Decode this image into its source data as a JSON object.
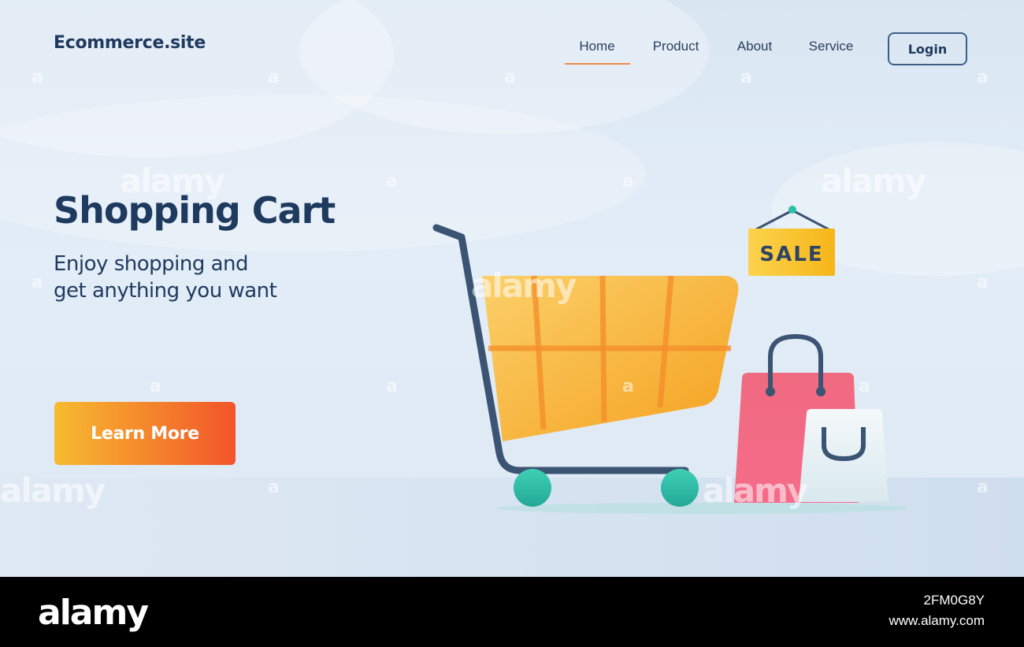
{
  "brand": {
    "name": "Ecommerce.site"
  },
  "nav": {
    "items": [
      {
        "label": "Home",
        "active": true
      },
      {
        "label": "Product"
      },
      {
        "label": "About"
      },
      {
        "label": "Service"
      }
    ],
    "login_label": "Login"
  },
  "hero": {
    "title": "Shopping Cart",
    "subtitle_line1": "Enjoy shopping and",
    "subtitle_line2": "get anything you want",
    "cta_label": "Learn More"
  },
  "illustration": {
    "sign_text": "SALE",
    "icons": [
      "shopping-cart-icon",
      "sale-sign-icon",
      "shopping-bag-icon"
    ]
  },
  "watermark": {
    "text": "alamy",
    "mark": "a"
  },
  "footer": {
    "logo": "alamy",
    "image_id": "2FM0G8Y",
    "url": "www.alamy.com"
  },
  "colors": {
    "primary_text": "#1f3a5f",
    "accent": "#f08a4b",
    "cta_gradient_start": "#f7bb2f",
    "cta_gradient_end": "#f2542a",
    "background": "#e3edf7"
  }
}
